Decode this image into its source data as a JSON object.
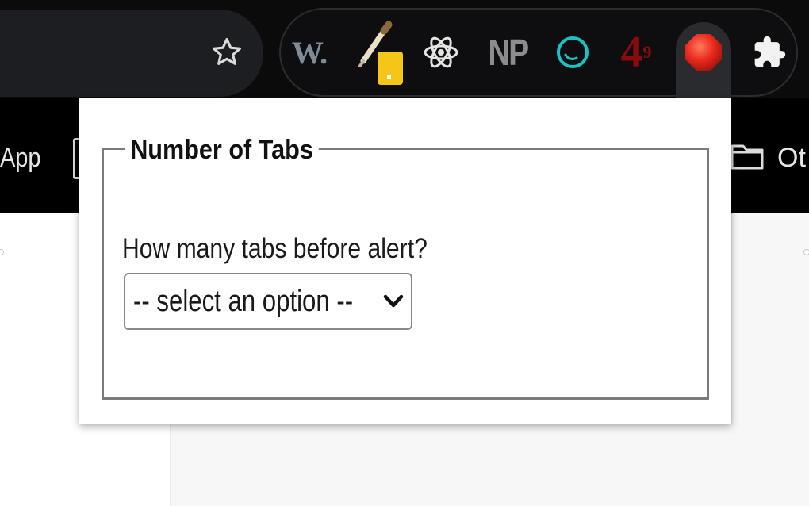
{
  "toolbar": {
    "bookmark_star": "star-icon",
    "extensions": [
      {
        "id": "w",
        "label": "W.",
        "icon": "w-extension-icon"
      },
      {
        "id": "eyedropper",
        "icon": "eyedropper-icon",
        "badge_color": "#f5c518"
      },
      {
        "id": "react",
        "icon": "react-atom-icon"
      },
      {
        "id": "np",
        "label": "NP",
        "icon": "np-extension-icon"
      },
      {
        "id": "circle",
        "icon": "teal-circle-icon",
        "color": "#18c3c3"
      },
      {
        "id": "four",
        "label": "4",
        "superscript": "9",
        "icon": "four-nine-icon",
        "color": "#8b0a0a"
      },
      {
        "id": "stop",
        "icon": "stop-sign-icon",
        "color": "#e8291c",
        "active": true
      },
      {
        "id": "puzzle",
        "icon": "puzzle-piece-icon"
      }
    ]
  },
  "bookmarks": {
    "left_label": "App",
    "right_label": "Ot",
    "folder_icon": "folder-icon"
  },
  "popup": {
    "legend": "Number of Tabs",
    "prompt": "How many tabs before alert?",
    "select": {
      "selected": "-- select an option --",
      "chevron": "chevron-down-icon"
    }
  },
  "colors": {
    "toolbar_bg": "#0b0b0b",
    "bookmarks_bg": "#000000",
    "popup_bg": "#ffffff",
    "fieldset_border": "#7b7b7b"
  }
}
